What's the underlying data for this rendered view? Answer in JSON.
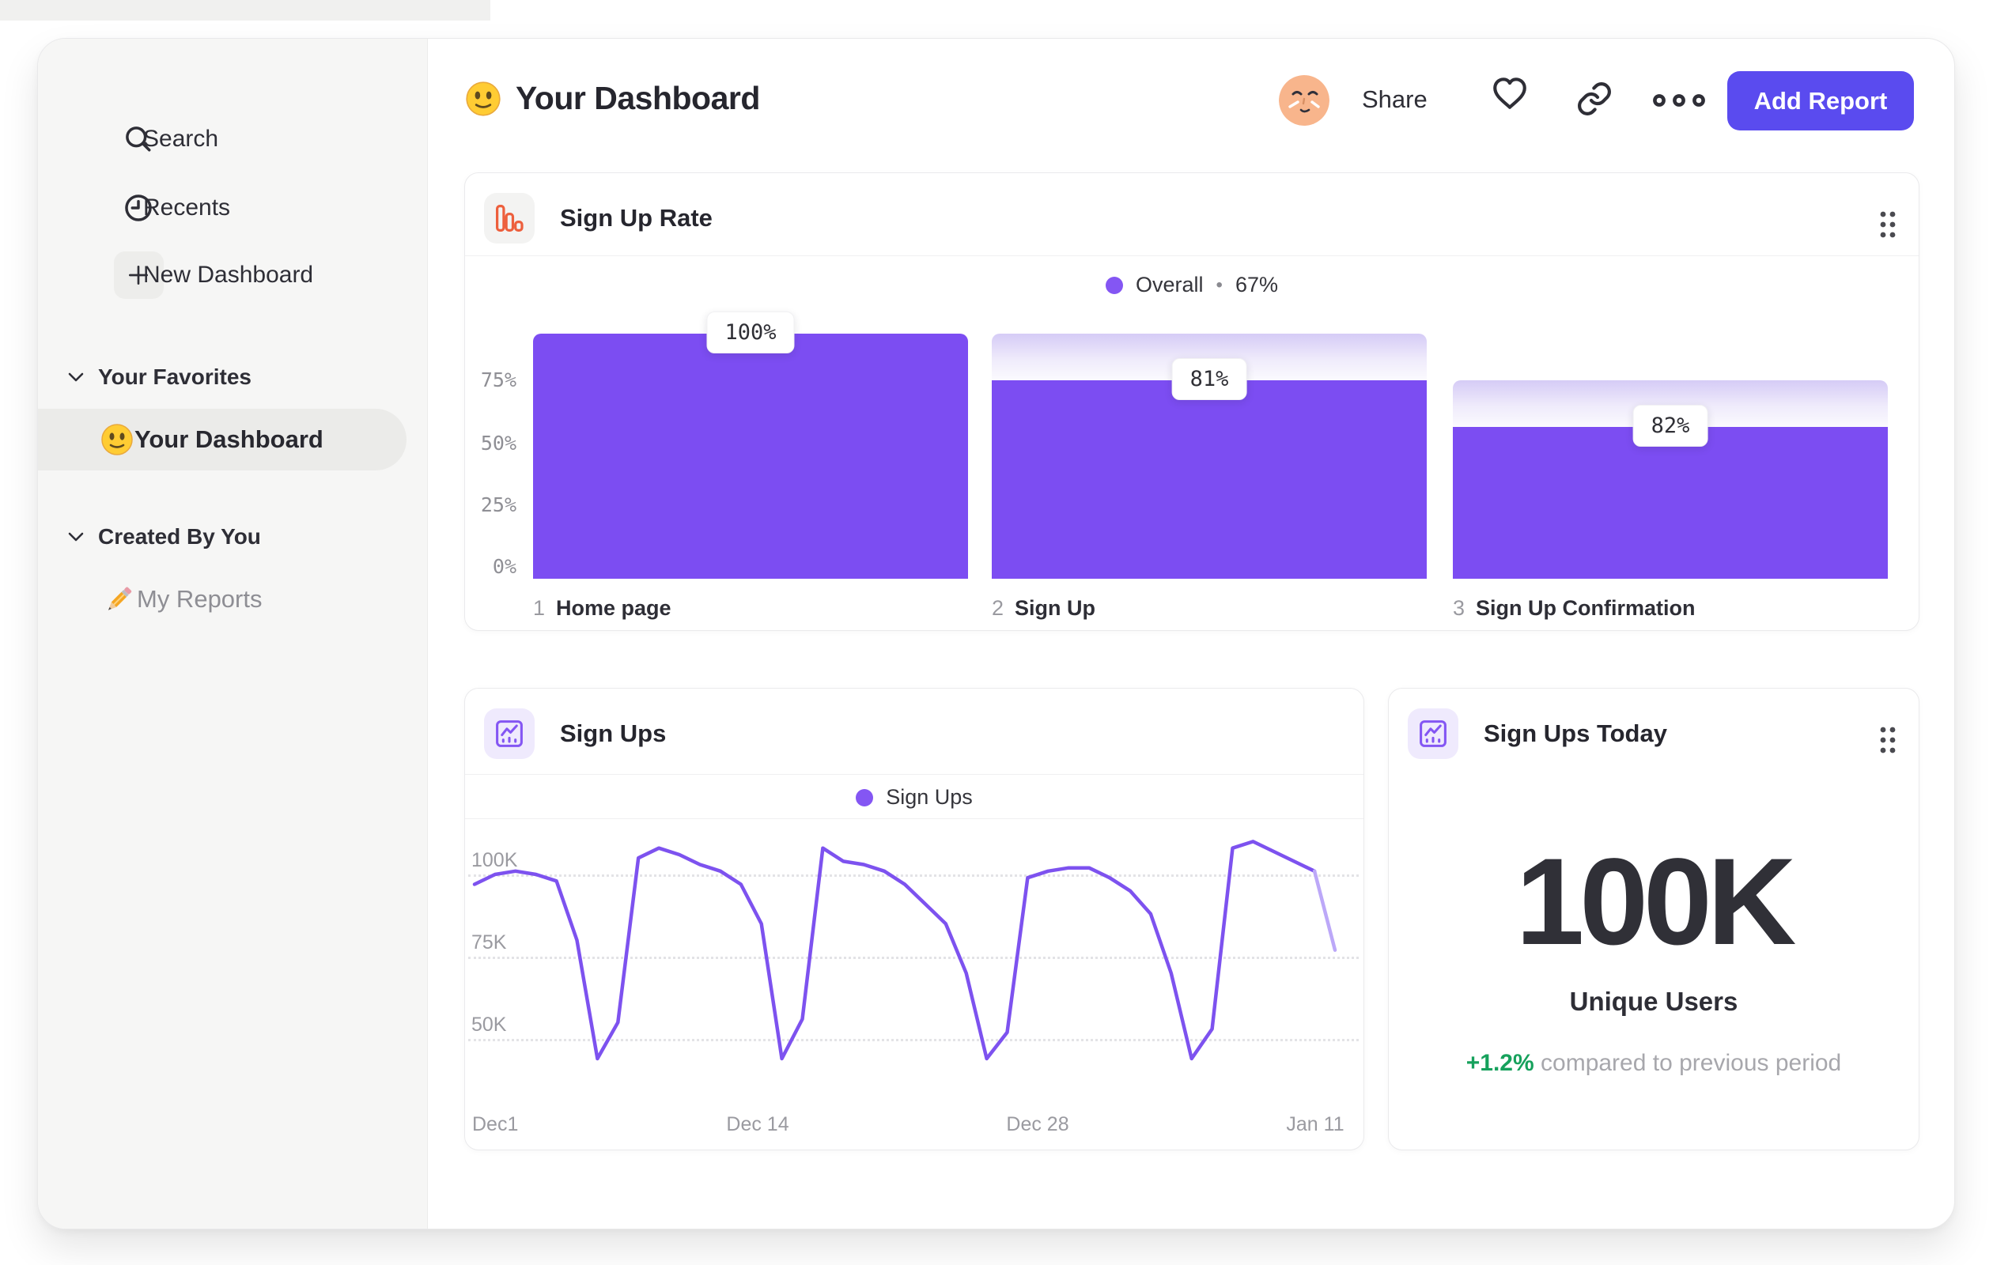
{
  "sidebar": {
    "items": [
      {
        "label": "Search"
      },
      {
        "label": "Recents"
      },
      {
        "label": "New Dashboard"
      }
    ],
    "sections": [
      {
        "title": "Your Favorites",
        "items": [
          {
            "label": "Your Dashboard",
            "icon": "smiley",
            "active": true
          }
        ]
      },
      {
        "title": "Created By You",
        "items": [
          {
            "label": "My Reports",
            "icon": "pencil",
            "active": false
          }
        ]
      }
    ]
  },
  "header": {
    "title": "Your Dashboard",
    "share_label": "Share",
    "add_report_label": "Add Report"
  },
  "cards": {
    "funnel": {
      "title": "Sign Up Rate",
      "legend": {
        "label": "Overall",
        "separator": "•",
        "value": "67%"
      },
      "y_ticks": [
        "75%",
        "50%",
        "25%",
        "0%"
      ],
      "steps": [
        {
          "index": "1",
          "label": "Home page",
          "value_label": "100%"
        },
        {
          "index": "2",
          "label": "Sign Up",
          "value_label": "81%"
        },
        {
          "index": "3",
          "label": "Sign Up Confirmation",
          "value_label": "82%"
        }
      ]
    },
    "line": {
      "title": "Sign Ups",
      "legend_label": "Sign Ups",
      "y_ticks": [
        "100K",
        "75K",
        "50K"
      ],
      "x_ticks": [
        "Dec1",
        "Dec 14",
        "Dec 28",
        "Jan 11"
      ]
    },
    "metric": {
      "title": "Sign Ups Today",
      "value": "100K",
      "label": "Unique Users",
      "delta": "+1.2%",
      "delta_note": "compared to previous period"
    }
  },
  "colors": {
    "accent_purple": "#7C4DF2",
    "button_indigo": "#5A4BEF",
    "positive_green": "#16A15C",
    "funnel_icon_orange": "#ED5F3D",
    "avatar_peach": "#F8B58C"
  },
  "chart_data": [
    {
      "type": "bar",
      "subtype": "funnel",
      "title": "Sign Up Rate",
      "legend": "Overall • 67%",
      "overall_conversion_pct": 67,
      "categories": [
        "Home page",
        "Sign Up",
        "Sign Up Confirmation"
      ],
      "conversion_from_previous_pct": [
        100,
        81,
        82
      ],
      "overall_height_pct": [
        100,
        81,
        62
      ],
      "prev_height_pct": [
        100,
        100,
        81
      ],
      "ylim": [
        0,
        100
      ],
      "y_ticks_pct": [
        75,
        50,
        25,
        0
      ]
    },
    {
      "type": "line",
      "title": "Sign Ups",
      "series_name": "Sign Ups",
      "unit": "K users per day",
      "x_ticks": [
        "Dec1",
        "Dec 14",
        "Dec 28",
        "Jan 11"
      ],
      "x_range_days": 42,
      "values": [
        97,
        100,
        101,
        100,
        98,
        80,
        44,
        55,
        105,
        108,
        106,
        103,
        101,
        97,
        85,
        44,
        56,
        108,
        104,
        103,
        101,
        97,
        91,
        85,
        70,
        44,
        52,
        99,
        101,
        102,
        102,
        99,
        95,
        88,
        70,
        44,
        53,
        108,
        110,
        107,
        104,
        101,
        77
      ],
      "ylim": [
        40,
        115
      ],
      "y_gridlines": [
        100,
        75,
        50
      ],
      "grid": "dotted"
    }
  ]
}
